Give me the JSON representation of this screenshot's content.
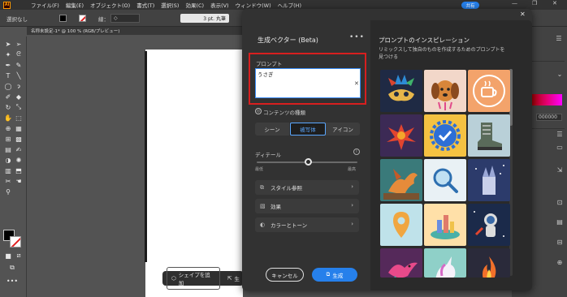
{
  "app": {
    "logo": "Ai"
  },
  "menubar": {
    "items": [
      "ファイル(F)",
      "編集(E)",
      "オブジェクト(O)",
      "書式(T)",
      "選択(S)",
      "効果(C)",
      "表示(V)",
      "ウィンドウ(W)",
      "ヘルプ(H)"
    ],
    "share_label": "共有",
    "window_controls": [
      "—",
      "❐",
      "✕"
    ]
  },
  "controlbar": {
    "selection_label": "選択なし",
    "stroke_label": "線：",
    "stroke_style_label": "3 pt. 丸筆"
  },
  "document": {
    "tab_label": "名称未設定-1* @ 100 % (RGB/プレビュー)",
    "tab_close": "✕"
  },
  "contextbar": {
    "add_shape_label": "シェイプを追加",
    "second_label": "生"
  },
  "right_panel": {
    "hex_value": "000000"
  },
  "dialog": {
    "title": "生成ベクター (Beta)",
    "more_label": "•••",
    "close_label": "✕",
    "prompt": {
      "label": "プロンプト",
      "value": "うさぎ",
      "clear_label": "✕"
    },
    "content_type": {
      "label": "コンテンツの種類",
      "options": [
        "シーン",
        "被写体",
        "アイコン"
      ],
      "selected": "被写体"
    },
    "detail": {
      "label": "ディテール",
      "info": "i",
      "min_label": "最低",
      "max_label": "最高",
      "value": 0.5
    },
    "accordions": [
      {
        "label": "スタイル参照",
        "icon": "style-reference-icon"
      },
      {
        "label": "効果",
        "icon": "effects-icon"
      },
      {
        "label": "カラーとトーン",
        "icon": "color-tone-icon"
      }
    ],
    "cancel_label": "キャンセル",
    "generate_label": "生成",
    "inspiration": {
      "title": "プロンプトのインスピレーション",
      "subtitle": "リミックスして独自のものを作成するためのプロンプトを見つける",
      "items": [
        {
          "name": "mask",
          "bg": "#1f2a44"
        },
        {
          "name": "dog",
          "bg": "#f2d7c9"
        },
        {
          "name": "coffee",
          "bg": "#f3a36b"
        },
        {
          "name": "phoenix",
          "bg": "#3c2a55"
        },
        {
          "name": "gear-check",
          "bg": "#f5c242"
        },
        {
          "name": "boot",
          "bg": "#b9d0d8"
        },
        {
          "name": "dragon",
          "bg": "#3a7a7a"
        },
        {
          "name": "magnifier",
          "bg": "#e9f1f5"
        },
        {
          "name": "castle",
          "bg": "#2c3b6b"
        },
        {
          "name": "pin",
          "bg": "#bfe2ea"
        },
        {
          "name": "city-island",
          "bg": "#ffe0a8"
        },
        {
          "name": "astronaut",
          "bg": "#1b2a4a"
        },
        {
          "name": "bird",
          "bg": "#55295a"
        },
        {
          "name": "unicorn",
          "bg": "#8fd0c8"
        },
        {
          "name": "fire",
          "bg": "#2a2a3a"
        }
      ]
    }
  }
}
